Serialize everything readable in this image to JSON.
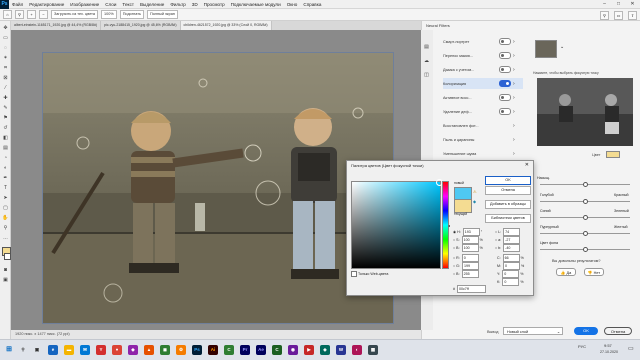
{
  "menubar": {
    "app_icon": "Ps",
    "items": [
      "Файл",
      "Редактирование",
      "Изображение",
      "Слои",
      "Текст",
      "Выделение",
      "Фильтр",
      "3D",
      "Просмотр",
      "Подключаемые модули",
      "Окно",
      "Справка"
    ]
  },
  "optbar": {
    "btn1": "Загрузить из тех. цвета",
    "btn2": "100%",
    "btn3": "Подогнать",
    "btn4": "Полный экран"
  },
  "tabs": [
    "albert-einstein-1165171_1920.jpg @ 44,4% (RGB/8#)",
    "pic-vyu-2188415_1920.jpg @ 45,6% (RGB/8#)",
    "children-4621572_1920.jpg @ 33% (Слой 0, RGB/8#)"
  ],
  "status": "1920 пикс. x 1477 пикс. (72 ppi)",
  "neural_filters": {
    "panel_title": "Neural Filters",
    "items": [
      "Смарт-портрет",
      "Перенос макия...",
      "Дымка с учетом...",
      "Колоризация",
      "Активное восс...",
      "Удаление деф...",
      "Восстановлен фот...",
      "Пыль и царапины",
      "Уменьшение шума"
    ],
    "hint": "Нажмите, чтобы выбрать фокусную точку",
    "color_label": "Цвет",
    "sliders": [
      "Насыщ.",
      "Голубой",
      "Синий",
      "Пурпурный",
      "Цвет фона"
    ],
    "slider_right": [
      "Красный",
      "Зеленый",
      "Желтый"
    ],
    "feedback_q": "Вы довольны результатом?",
    "yes": "Да",
    "no": "Нет",
    "output_label": "Вывод",
    "output_value": "Новый слой",
    "ok": "OK",
    "cancel": "Отмена"
  },
  "color_picker": {
    "title": "Палитра цветов (Цвет фокусной точки)",
    "new_label": "новый",
    "current_label": "текущий",
    "ok": "OK",
    "cancel": "Отмена",
    "add_swatches": "Добавить в образцы",
    "libraries": "Библиотеки цветов",
    "web_only": "Только Web-цвета",
    "H": "193",
    "S": "100",
    "Br": "100",
    "R": "0",
    "G": "199",
    "B": "255",
    "L": "74",
    "a": "-27",
    "b": "-40",
    "C": "66",
    "M": "0",
    "Y": "0",
    "K": "0",
    "hex": "00c7ff",
    "deg": "°",
    "pct": "%"
  },
  "taskbar": {
    "time": "9:57",
    "date": "27.10.2020",
    "lang": "РУС"
  },
  "colors": {
    "accent": "#2c62d4",
    "picked": "#00c7ff",
    "new_swatch": "#4fc8f2",
    "current_swatch": "#f4dc92"
  }
}
